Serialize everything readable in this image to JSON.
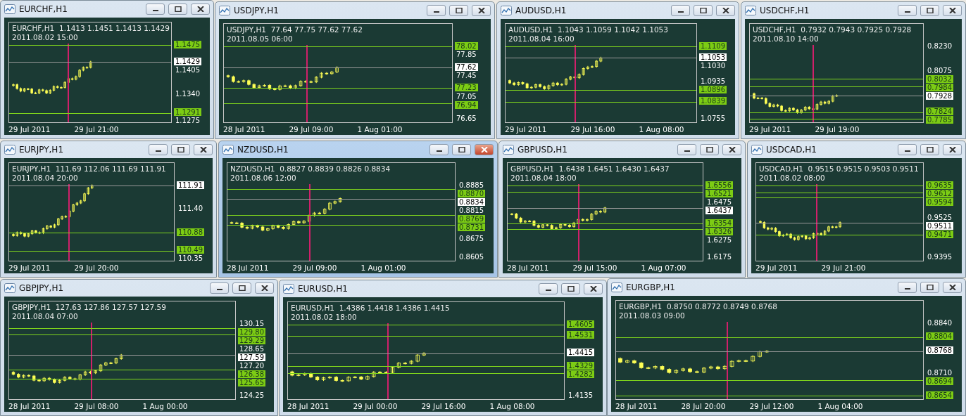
{
  "windows": [
    {
      "title": "EURCHF,H1",
      "active": false,
      "quote": "EURCHF,H1  1.1413 1.1451 1.1413 1.1429",
      "time": "2011.08.02 15:00",
      "prices": [
        {
          "text": "1.1475",
          "kind": "level"
        },
        {
          "text": "1.1429",
          "kind": "current"
        },
        {
          "text": "1.1405",
          "kind": "tick"
        },
        {
          "text": "1.1340",
          "kind": "tick"
        },
        {
          "text": "1.1291",
          "kind": "level"
        },
        {
          "text": "1.1275",
          "kind": "tick"
        }
      ],
      "dates": [
        "29 Jul 2011",
        "29 Jul 21:00"
      ]
    },
    {
      "title": "USDJPY,H1",
      "active": false,
      "quote": "USDJPY,H1  77.64 77.75 77.62 77.62",
      "time": "2011.08.05 06:00",
      "prices": [
        {
          "text": "78.02",
          "kind": "level"
        },
        {
          "text": "77.85",
          "kind": "tick"
        },
        {
          "text": "77.62",
          "kind": "current"
        },
        {
          "text": "77.45",
          "kind": "tick"
        },
        {
          "text": "77.23",
          "kind": "level"
        },
        {
          "text": "77.05",
          "kind": "tick"
        },
        {
          "text": "76.94",
          "kind": "level"
        },
        {
          "text": "76.65",
          "kind": "tick"
        }
      ],
      "dates": [
        "28 Jul 2011",
        "29 Jul 09:00",
        "1 Aug 01:00"
      ]
    },
    {
      "title": "AUDUSD,H1",
      "active": false,
      "quote": "AUDUSD,H1  1.1043 1.1059 1.1042 1.1053",
      "time": "2011.08.04 16:00",
      "prices": [
        {
          "text": "1.1109",
          "kind": "level"
        },
        {
          "text": "1.1053",
          "kind": "current"
        },
        {
          "text": "1.1030",
          "kind": "tick"
        },
        {
          "text": "1.0935",
          "kind": "tick"
        },
        {
          "text": "1.0896",
          "kind": "level"
        },
        {
          "text": "1.0839",
          "kind": "level"
        },
        {
          "text": "1.0755",
          "kind": "tick"
        }
      ],
      "dates": [
        "29 Jul 2011",
        "29 Jul 16:00",
        "1 Aug 08:00"
      ]
    },
    {
      "title": "USDCHF,H1",
      "active": false,
      "quote": "USDCHF,H1  0.7932 0.7943 0.7925 0.7928",
      "time": "2011.08.10 14:00",
      "prices": [
        {
          "text": "0.8230",
          "kind": "tick"
        },
        {
          "text": "0.8075",
          "kind": "tick"
        },
        {
          "text": "0.8032",
          "kind": "level"
        },
        {
          "text": "0.7984",
          "kind": "level"
        },
        {
          "text": "0.7928",
          "kind": "current"
        },
        {
          "text": "0.7824",
          "kind": "level"
        },
        {
          "text": "0.7785",
          "kind": "level"
        }
      ],
      "dates": [
        "29 Jul 2011",
        "29 Jul 19:00"
      ]
    },
    {
      "title": "EURJPY,H1",
      "active": false,
      "quote": "EURJPY,H1  111.69 112.06 111.69 111.91",
      "time": "2011.08.04 20:00",
      "prices": [
        {
          "text": "111.91",
          "kind": "current"
        },
        {
          "text": "111.40",
          "kind": "tick"
        },
        {
          "text": "110.88",
          "kind": "level"
        },
        {
          "text": "110.49",
          "kind": "level"
        },
        {
          "text": "110.35",
          "kind": "tick"
        }
      ],
      "dates": [
        "29 Jul 2011",
        "29 Jul 20:00"
      ]
    },
    {
      "title": "NZDUSD,H1",
      "active": true,
      "quote": "NZDUSD,H1  0.8827 0.8839 0.8826 0.8834",
      "time": "2011.08.06 12:00",
      "prices": [
        {
          "text": "0.8885",
          "kind": "tick"
        },
        {
          "text": "0.8870",
          "kind": "level"
        },
        {
          "text": "0.8834",
          "kind": "current"
        },
        {
          "text": "0.8815",
          "kind": "tick"
        },
        {
          "text": "0.8769",
          "kind": "level"
        },
        {
          "text": "0.8731",
          "kind": "level"
        },
        {
          "text": "0.8675",
          "kind": "tick"
        },
        {
          "text": "0.8605",
          "kind": "tick"
        }
      ],
      "dates": [
        "28 Jul 2011",
        "29 Jul 09:00",
        "1 Aug 01:00"
      ]
    },
    {
      "title": "GBPUSD,H1",
      "active": false,
      "quote": "GBPUSD,H1  1.6438 1.6451 1.6430 1.6437",
      "time": "2011.08.04 18:00",
      "prices": [
        {
          "text": "1.6556",
          "kind": "level"
        },
        {
          "text": "1.6521",
          "kind": "level"
        },
        {
          "text": "1.6475",
          "kind": "tick"
        },
        {
          "text": "1.6437",
          "kind": "current"
        },
        {
          "text": "1.6354",
          "kind": "level"
        },
        {
          "text": "1.6326",
          "kind": "level"
        },
        {
          "text": "1.6275",
          "kind": "tick"
        },
        {
          "text": "1.6175",
          "kind": "tick"
        }
      ],
      "dates": [
        "28 Jul 2011",
        "29 Jul 15:00",
        "1 Aug 07:00"
      ]
    },
    {
      "title": "USDCAD,H1",
      "active": false,
      "quote": "USDCAD,H1  0.9515 0.9515 0.9503 0.9511",
      "time": "2011.08.02 08:00",
      "prices": [
        {
          "text": "0.9635",
          "kind": "level"
        },
        {
          "text": "0.9612",
          "kind": "level"
        },
        {
          "text": "0.9594",
          "kind": "level"
        },
        {
          "text": "0.9525",
          "kind": "tick"
        },
        {
          "text": "0.9511",
          "kind": "current"
        },
        {
          "text": "0.9471",
          "kind": "level"
        },
        {
          "text": "0.9395",
          "kind": "tick"
        }
      ],
      "dates": [
        "29 Jul 2011",
        "29 Jul 21:00"
      ]
    },
    {
      "title": "GBPJPY,H1",
      "active": false,
      "quote": "GBPJPY,H1  127.63 127.86 127.57 127.59",
      "time": "2011.08.04 07:00",
      "prices": [
        {
          "text": "130.15",
          "kind": "tick"
        },
        {
          "text": "129.80",
          "kind": "level"
        },
        {
          "text": "129.29",
          "kind": "level"
        },
        {
          "text": "128.65",
          "kind": "tick"
        },
        {
          "text": "127.59",
          "kind": "current"
        },
        {
          "text": "127.20",
          "kind": "tick"
        },
        {
          "text": "126.38",
          "kind": "level"
        },
        {
          "text": "125.65",
          "kind": "level"
        },
        {
          "text": "124.25",
          "kind": "tick"
        }
      ],
      "dates": [
        "28 Jul 2011",
        "29 Jul 08:00",
        "1 Aug 00:00"
      ]
    },
    {
      "title": "EURUSD,H1",
      "active": false,
      "quote": "EURUSD,H1  1.4386 1.4418 1.4386 1.4415",
      "time": "2011.08.02 18:00",
      "prices": [
        {
          "text": "1.4605",
          "kind": "level"
        },
        {
          "text": "1.4531",
          "kind": "level"
        },
        {
          "text": "1.4415",
          "kind": "current"
        },
        {
          "text": "1.4329",
          "kind": "level"
        },
        {
          "text": "1.4282",
          "kind": "level"
        },
        {
          "text": "1.4135",
          "kind": "tick"
        }
      ],
      "dates": [
        "28 Jul 2011",
        "29 Jul 00:00",
        "29 Jul 16:00",
        "1 Aug 08:00"
      ]
    },
    {
      "title": "EURGBP,H1",
      "active": false,
      "quote": "EURGBP,H1  0.8750 0.8772 0.8749 0.8768",
      "time": "2011.08.03 09:00",
      "prices": [
        {
          "text": "0.8840",
          "kind": "tick"
        },
        {
          "text": "0.8804",
          "kind": "level"
        },
        {
          "text": "0.8768",
          "kind": "current"
        },
        {
          "text": "0.8710",
          "kind": "tick"
        },
        {
          "text": "0.8694",
          "kind": "level"
        },
        {
          "text": "0.8654",
          "kind": "level"
        }
      ],
      "dates": [
        "28 Jul 2011",
        "28 Jul 20:00",
        "29 Jul 12:00",
        "1 Aug 04:00"
      ]
    }
  ]
}
